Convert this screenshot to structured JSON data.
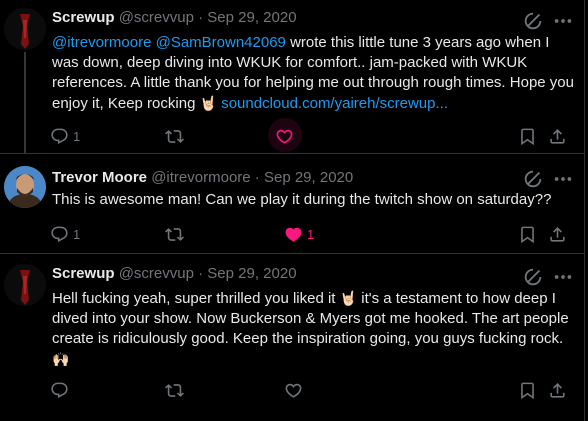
{
  "colors": {
    "background": "#000000",
    "text": "#e7e9ea",
    "muted": "#71767b",
    "link": "#1d9bf0",
    "like_active": "#f91880",
    "divider": "#2f3336"
  },
  "tweets": [
    {
      "name": "Screwup",
      "handle": "@screvvup",
      "sep": "·",
      "date": "Sep 29, 2020",
      "mention1": "@itrevormoore",
      "mention2": "@SamBrown42069",
      "text1": " wrote this little tune 3 years ago when I was down, deep diving into WKUK for comfort.. jam-packed with WKUK references. A little thank you for helping me out through rough times. Hope you enjoy it, Keep rocking ",
      "emoji": "🤘🏻",
      "link": "soundcloud.com/yaireh/screwup...",
      "replies": "1",
      "retweets": "",
      "likes": "",
      "like_hover": true
    },
    {
      "name": "Trevor Moore",
      "handle": "@itrevormoore",
      "sep": "·",
      "date": "Sep 29, 2020",
      "text": "This is awesome man! Can we play it during the twitch show on saturday??",
      "replies": "1",
      "retweets": "",
      "likes": "1",
      "liked": true
    },
    {
      "name": "Screwup",
      "handle": "@screvvup",
      "sep": "·",
      "date": "Sep 29, 2020",
      "text1": "Hell fucking yeah, super thrilled you liked it ",
      "emoji1": "🤘🏻",
      "text2": " it's a testament to how deep I dived into your show. Now Buckerson & Myers got me hooked. The art people create is ridiculously good. Keep the inspiration going, you guys fucking rock. ",
      "emoji2": "🙌🏻",
      "replies": "",
      "retweets": "",
      "likes": ""
    }
  ]
}
